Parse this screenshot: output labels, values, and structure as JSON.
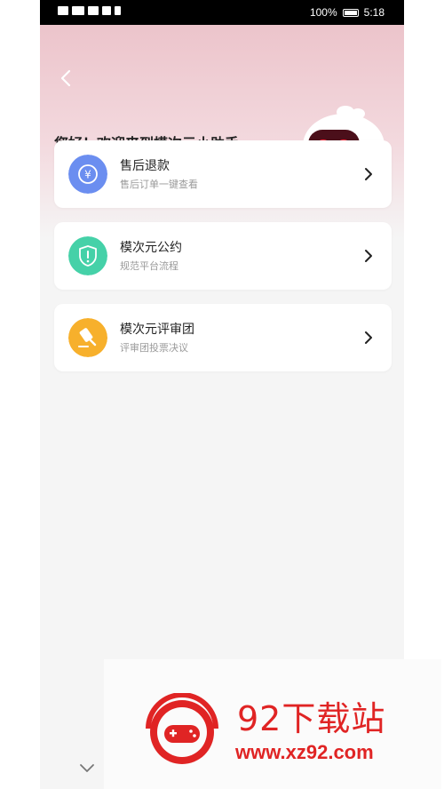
{
  "status_bar": {
    "battery": "100%",
    "time": "5:18"
  },
  "greeting": "您好！欢迎来到模次元小助手",
  "menu": [
    {
      "title": "售后退款",
      "subtitle": "售后订单一键查看",
      "icon": "refund-yen-icon",
      "color": "#6b8ef0"
    },
    {
      "title": "模次元公约",
      "subtitle": "规范平台流程",
      "icon": "shield-alert-icon",
      "color": "#45d1a8"
    },
    {
      "title": "模次元评审团",
      "subtitle": "评审团投票决议",
      "icon": "gavel-icon",
      "color": "#f7b02c"
    }
  ],
  "watermark": {
    "title": "92下载站",
    "url": "www.xz92.com",
    "color": "#e02424"
  }
}
